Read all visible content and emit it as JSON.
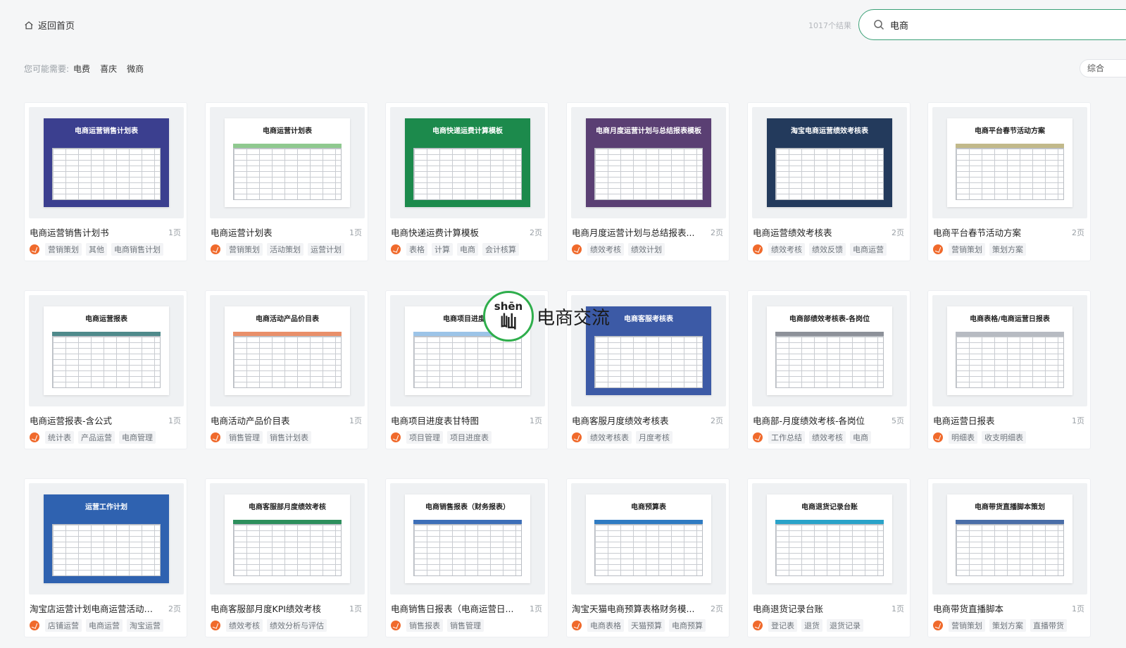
{
  "header": {
    "back_label": "返回首页",
    "result_count": "1017个结果",
    "search_value": "电商",
    "accent": "#3aa076"
  },
  "suggest": {
    "label": "您可能需要:",
    "keywords": [
      "电费",
      "喜庆",
      "微商"
    ]
  },
  "sort_label": "综合",
  "cards": [
    {
      "title": "电商运营销售计划书",
      "pages": "1页",
      "tags": [
        "营销策划",
        "其他",
        "电商销售计划"
      ],
      "thumb_title": "电商运营销售计划表",
      "theme": "#3b3f8f"
    },
    {
      "title": "电商运营计划表",
      "pages": "1页",
      "tags": [
        "营销策划",
        "活动策划",
        "运营计划"
      ],
      "thumb_title": "电商运营计划表",
      "theme": "#8fc98f"
    },
    {
      "title": "电商快递运费计算模板",
      "pages": "2页",
      "tags": [
        "表格",
        "计算",
        "电商",
        "会计核算"
      ],
      "thumb_title": "电商快递运费计算模板",
      "theme": "#1c8a4c"
    },
    {
      "title": "电商月度运营计划与总结报表...",
      "pages": "2页",
      "tags": [
        "绩效考核",
        "绩效计划"
      ],
      "thumb_title": "电商月度运营计划与总结报表模板",
      "theme": "#5a3f73"
    },
    {
      "title": "电商运营绩效考核表",
      "pages": "2页",
      "tags": [
        "绩效考核",
        "绩效反馈",
        "电商运营"
      ],
      "thumb_title": "淘宝电商运营绩效考核表",
      "theme": "#233a5c"
    },
    {
      "title": "电商平台春节活动方案",
      "pages": "2页",
      "tags": [
        "营销策划",
        "策划方案"
      ],
      "thumb_title": "电商平台春节活动方案",
      "theme": "#c2b98a"
    },
    {
      "title": "电商运营报表-含公式",
      "pages": "1页",
      "tags": [
        "统计表",
        "产品运营",
        "电商管理"
      ],
      "thumb_title": "电商运营报表",
      "theme": "#4f8a8b"
    },
    {
      "title": "电商活动产品价目表",
      "pages": "1页",
      "tags": [
        "销售管理",
        "销售计划表"
      ],
      "thumb_title": "电商活动产品价目表",
      "theme": "#e98f6a"
    },
    {
      "title": "电商项目进度表甘特图",
      "pages": "1页",
      "tags": [
        "项目管理",
        "项目进度表"
      ],
      "thumb_title": "电商项目进度表",
      "theme": "#9cc4e8"
    },
    {
      "title": "电商客服月度绩效考核表",
      "pages": "2页",
      "tags": [
        "绩效考核表",
        "月度考核"
      ],
      "thumb_title": "电商客服考核表",
      "theme": "#3c5aa6"
    },
    {
      "title": "电商部-月度绩效考核-各岗位",
      "pages": "5页",
      "tags": [
        "工作总结",
        "绩效考核",
        "电商"
      ],
      "thumb_title": "电商部绩效考核表-各岗位",
      "theme": "#8d9199"
    },
    {
      "title": "电商运营日报表",
      "pages": "1页",
      "tags": [
        "明细表",
        "收支明细表"
      ],
      "thumb_title": "电商表格/电商运营日报表",
      "theme": "#b7bbc2"
    },
    {
      "title": "淘宝店运营计划电商运营活动E...",
      "pages": "2页",
      "tags": [
        "店铺运营",
        "电商运营",
        "淘宝运营"
      ],
      "thumb_title": "运营工作计划",
      "theme": "#2f62b0"
    },
    {
      "title": "电商客服部月度KPI绩效考核",
      "pages": "1页",
      "tags": [
        "绩效考核",
        "绩效分析与评估"
      ],
      "thumb_title": "电商客服部月度绩效考核",
      "theme": "#2d8f5c"
    },
    {
      "title": "电商销售日报表（电商运营日...",
      "pages": "1页",
      "tags": [
        "销售报表",
        "销售管理"
      ],
      "thumb_title": "电商销售报表（财务报表）",
      "theme": "#3d6fb8"
    },
    {
      "title": "淘宝天猫电商预算表格财务模...",
      "pages": "2页",
      "tags": [
        "电商表格",
        "天猫预算",
        "电商预算"
      ],
      "thumb_title": "电商预算表",
      "theme": "#2f7bc2"
    },
    {
      "title": "电商退货记录台账",
      "pages": "1页",
      "tags": [
        "登记表",
        "退货",
        "退货记录"
      ],
      "thumb_title": "电商退货记录台账",
      "theme": "#2aa3c9"
    },
    {
      "title": "电商带货直播脚本",
      "pages": "1页",
      "tags": [
        "营销策划",
        "策划方案",
        "直播带货"
      ],
      "thumb_title": "电商带货直播脚本策划",
      "theme": "#4a6ea8"
    }
  ],
  "watermark": {
    "pinyin": "shēn",
    "char": "屾",
    "text": "电商交流",
    "color": "#2fae4c"
  }
}
